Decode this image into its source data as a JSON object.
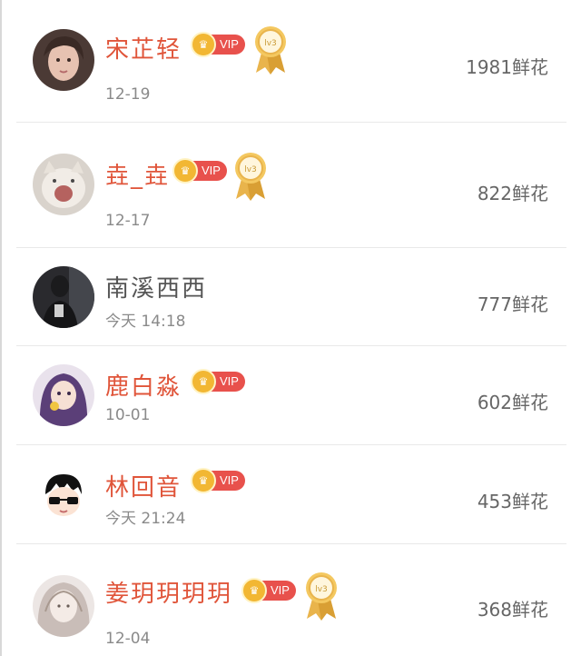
{
  "flower_unit": "鲜花",
  "vip_badge_text": "VIP",
  "medal_text": "lv3",
  "rows": [
    {
      "name": "宋芷轻",
      "date": "12-19",
      "flowers": "1981鲜花",
      "vip": true,
      "medal": true
    },
    {
      "name": "垚_垚",
      "date": "12-17",
      "flowers": "822鲜花",
      "vip": true,
      "medal": true
    },
    {
      "name": "南溪西西",
      "date": "今天 14:18",
      "flowers": "777鲜花",
      "vip": false,
      "medal": false
    },
    {
      "name": "鹿白淼",
      "date": "10-01",
      "flowers": "602鲜花",
      "vip": true,
      "medal": false
    },
    {
      "name": "林回音",
      "date": "今天 21:24",
      "flowers": "453鲜花",
      "vip": true,
      "medal": false
    },
    {
      "name": "姜玥玥玥玥",
      "date": "12-04",
      "flowers": "368鲜花",
      "vip": true,
      "medal": true
    }
  ],
  "colors": {
    "vip_name": "#e0553a",
    "plain_name": "#555555",
    "vip_badge": "#e8514c",
    "crown": "#f2b733",
    "medal_gold": "#e9b44c",
    "divider": "#e9e9e9"
  },
  "icons": [
    "avatar",
    "crown-icon",
    "medal-icon"
  ]
}
